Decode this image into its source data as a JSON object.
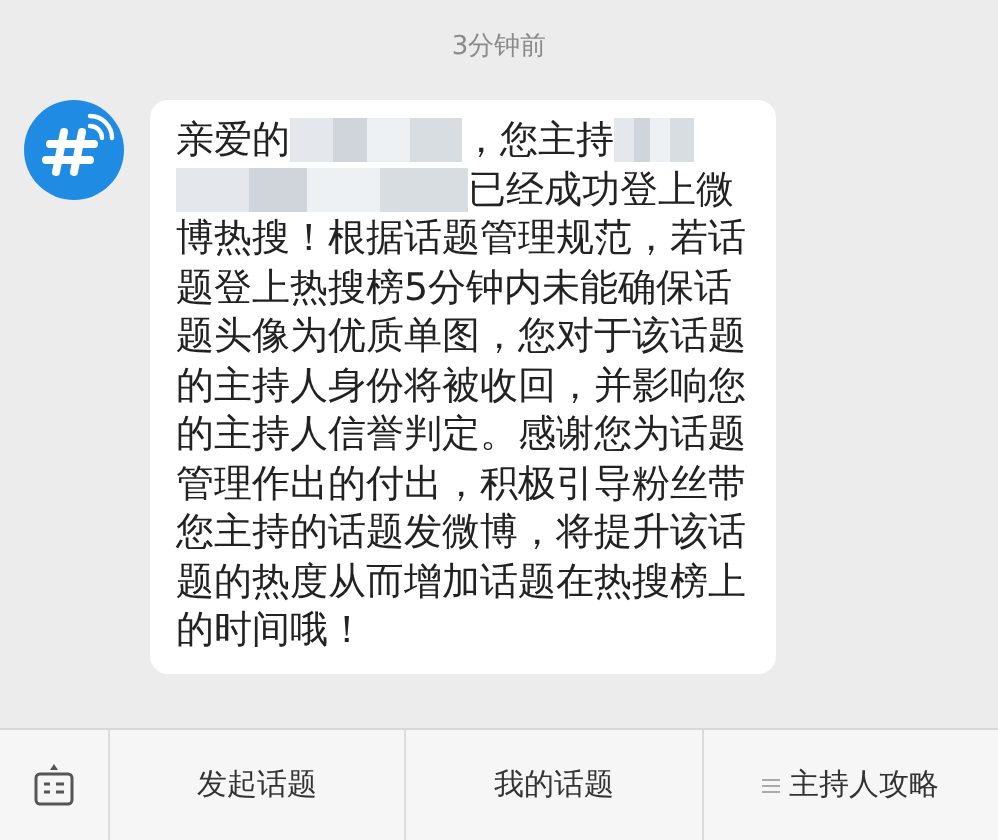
{
  "timestamp": "3分钟前",
  "message": {
    "lines": [
      [
        {
          "kind": "text",
          "text": "亲爱的"
        },
        {
          "kind": "redacted"
        },
        {
          "kind": "text",
          "text": "，您主持"
        },
        {
          "kind": "redacted"
        }
      ],
      [
        {
          "kind": "redacted"
        },
        {
          "kind": "text",
          "text": "已经成功登上微"
        }
      ]
    ],
    "body": "博热搜！根据话题管理规范，若话题登上热搜榜5分钟内未能确保话题头像为优质单图，您对于该话题的主持人身份将被收回，并影响您的主持人信誉判定。感谢您为话题管理作出的付出，积极引导粉丝带您主持的话题发微博，将提升该话题的热度从而增加话题在热搜榜上的时间哦！"
  },
  "menu": [
    {
      "label": "发起话题",
      "has_submenu": false
    },
    {
      "label": "我的话题",
      "has_submenu": false
    },
    {
      "label": "主持人攻略",
      "has_submenu": true
    }
  ]
}
